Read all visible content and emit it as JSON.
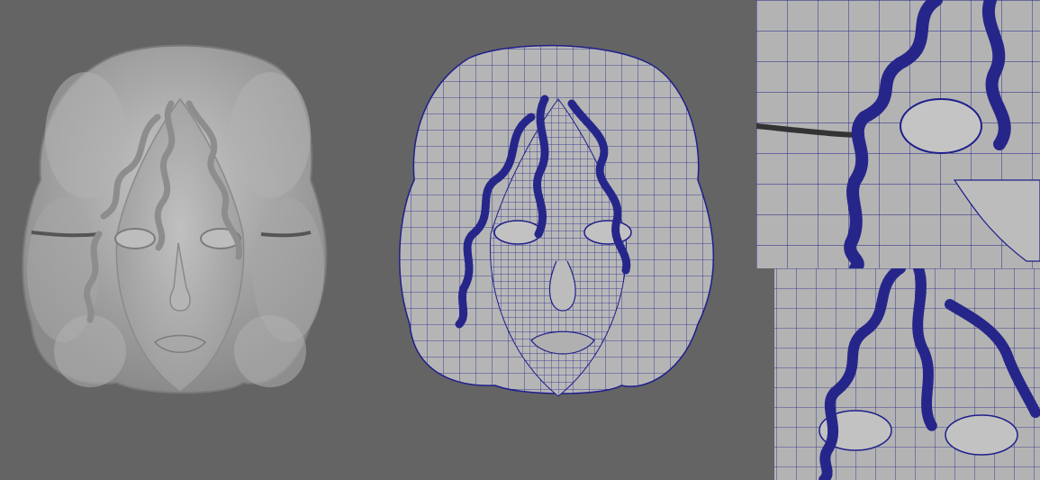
{
  "image": {
    "description_panels": [
      "shaded-render",
      "wireframe-render",
      "closeup-top",
      "closeup-bottom"
    ],
    "colors": {
      "background": "#646464",
      "clay": "#a9a9a9",
      "clay_light": "#c4c4c4",
      "clay_dark": "#7e7e7e",
      "wire": "#1f1f8c",
      "curl": "#26268a"
    }
  }
}
